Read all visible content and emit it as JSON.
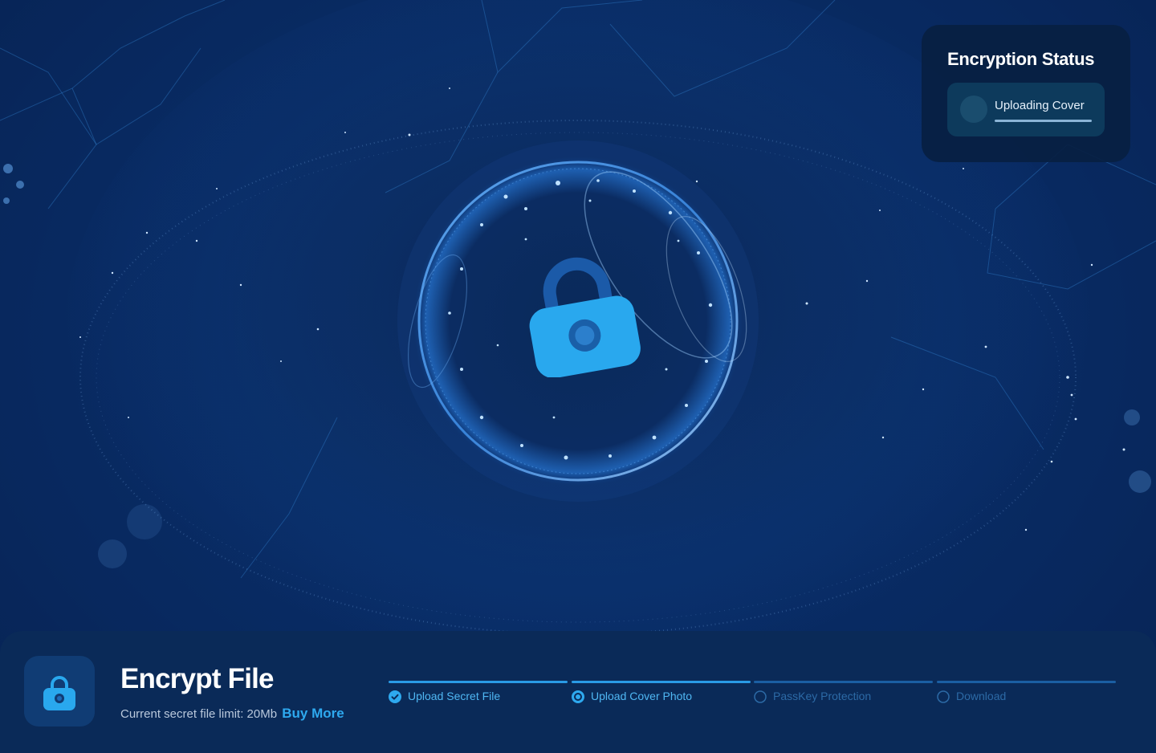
{
  "status_panel": {
    "title": "Encryption Status",
    "current_item": "Uploading Cover",
    "progress": 1.0
  },
  "bottom_bar": {
    "title": "Encrypt File",
    "limit_text": "Current secret file limit: 20Mb",
    "buy_more_label": "Buy More"
  },
  "steps": [
    {
      "label": "Upload Secret File",
      "state": "completed"
    },
    {
      "label": "Upload Cover Photo",
      "state": "current"
    },
    {
      "label": "PassKey Protection",
      "state": "pending"
    },
    {
      "label": "Download",
      "state": "pending"
    }
  ],
  "colors": {
    "accent": "#2ea9ef",
    "lock": "#29a8ee",
    "panel": "#082042",
    "background": "#0a3270"
  },
  "icons": {
    "center": "padlock-icon",
    "app": "padlock-icon",
    "completed_step": "check-circle-icon",
    "current_step": "radio-current-icon",
    "pending_step": "empty-circle-icon"
  }
}
